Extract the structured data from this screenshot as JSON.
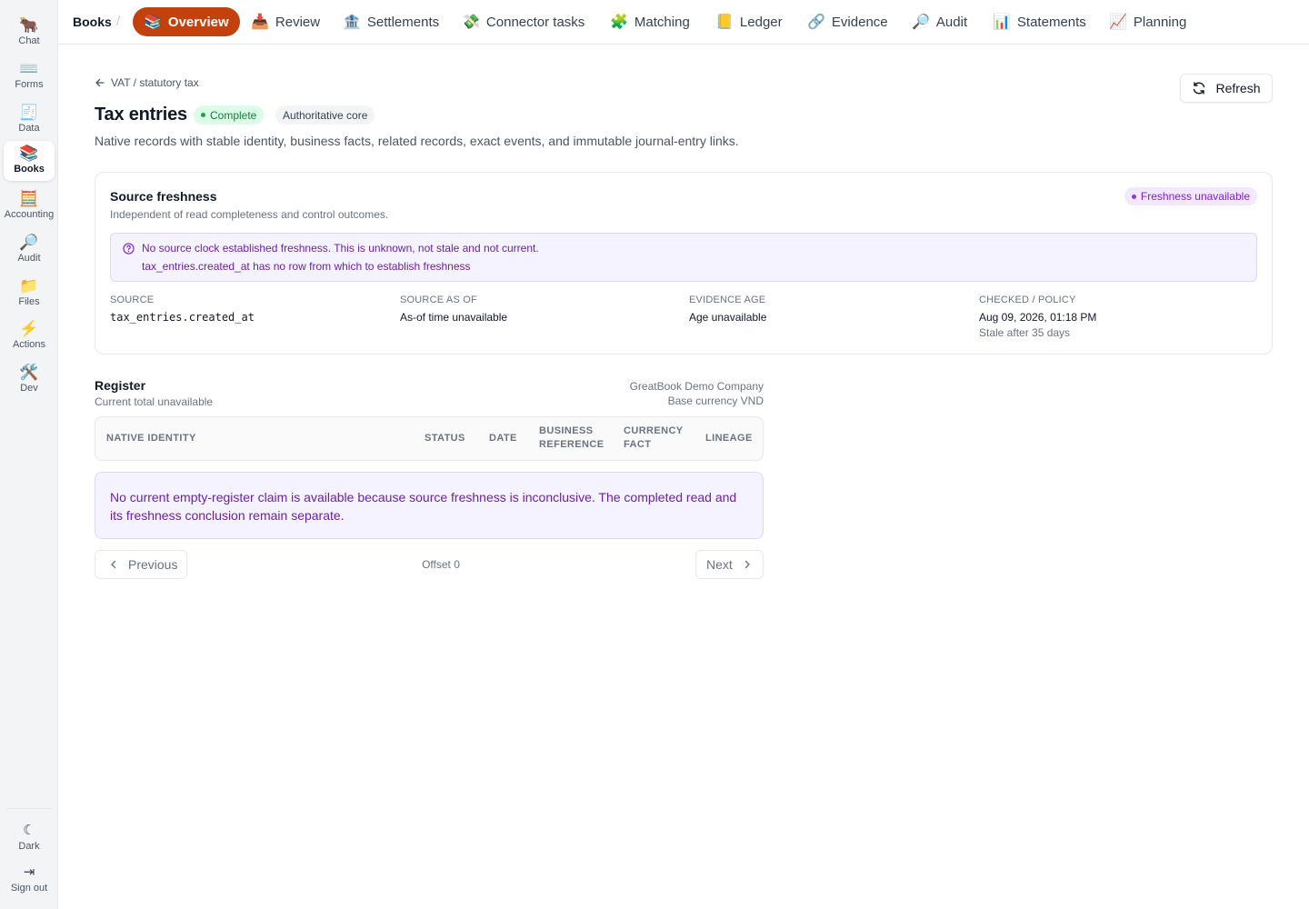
{
  "sidebar": {
    "items": [
      {
        "label": "Chat",
        "icon": "🐂"
      },
      {
        "label": "Forms",
        "icon": "⌨️"
      },
      {
        "label": "Data",
        "icon": "🧾"
      },
      {
        "label": "Books",
        "icon": "📚"
      },
      {
        "label": "Accounting",
        "icon": "🧮"
      },
      {
        "label": "Audit",
        "icon": "🔎"
      },
      {
        "label": "Files",
        "icon": "📁"
      },
      {
        "label": "Actions",
        "icon": "⚡"
      },
      {
        "label": "Dev",
        "icon": "🛠️"
      }
    ],
    "bottom": [
      {
        "label": "Dark",
        "icon": "☾"
      },
      {
        "label": "Sign out",
        "icon": "⇥"
      }
    ]
  },
  "topnav": {
    "root": "Books",
    "separator": "/",
    "tabs": [
      {
        "label": "Overview",
        "icon": "📚"
      },
      {
        "label": "Review",
        "icon": "📥"
      },
      {
        "label": "Settlements",
        "icon": "🏦"
      },
      {
        "label": "Connector tasks",
        "icon": "💸"
      },
      {
        "label": "Matching",
        "icon": "🧩"
      },
      {
        "label": "Ledger",
        "icon": "📒"
      },
      {
        "label": "Evidence",
        "icon": "🔗"
      },
      {
        "label": "Audit",
        "icon": "🔎"
      },
      {
        "label": "Statements",
        "icon": "📊"
      },
      {
        "label": "Planning",
        "icon": "📈"
      }
    ]
  },
  "header": {
    "back_label": "VAT / statutory tax",
    "title": "Tax entries",
    "status_badge": "Complete",
    "core_badge": "Authoritative core",
    "subtitle": "Native records with stable identity, business facts, related records, exact events, and immutable journal-entry links.",
    "refresh_label": "Refresh"
  },
  "freshness": {
    "title": "Source freshness",
    "subtitle": "Independent of read completeness and control outcomes.",
    "badge": "Freshness unavailable",
    "alert_line1": "No source clock established freshness. This is unknown, not stale and not current.",
    "alert_line2": "tax_entries.created_at has no row from which to establish freshness",
    "meta": [
      {
        "label": "Source",
        "value": "tax_entries.created_at"
      },
      {
        "label": "Source as of",
        "value": "As-of time unavailable"
      },
      {
        "label": "Evidence age",
        "value": "Age unavailable"
      },
      {
        "label": "Checked / policy",
        "value": "Aug 09, 2026, 01:18 PM",
        "sub": "Stale after 35 days"
      }
    ]
  },
  "register": {
    "title": "Register",
    "subtitle": "Current total unavailable",
    "company": "GreatBook Demo Company",
    "currency": "Base currency VND",
    "columns": [
      {
        "line1": "Native identity",
        "line2": ""
      },
      {
        "line1": "Status",
        "line2": ""
      },
      {
        "line1": "Date",
        "line2": ""
      },
      {
        "line1": "Business",
        "line2": "reference"
      },
      {
        "line1": "Currency",
        "line2": "fact"
      },
      {
        "line1": "Lineage",
        "line2": ""
      }
    ],
    "notice": "No current empty-register claim is available because source freshness is inconclusive. The completed read and its freshness conclusion remain separate."
  },
  "pagination": {
    "previous": "Previous",
    "offset": "Offset 0",
    "next": "Next"
  },
  "colors": {
    "accent": "#c2410c",
    "success": "#15803d",
    "purple": "#7e22ce"
  }
}
